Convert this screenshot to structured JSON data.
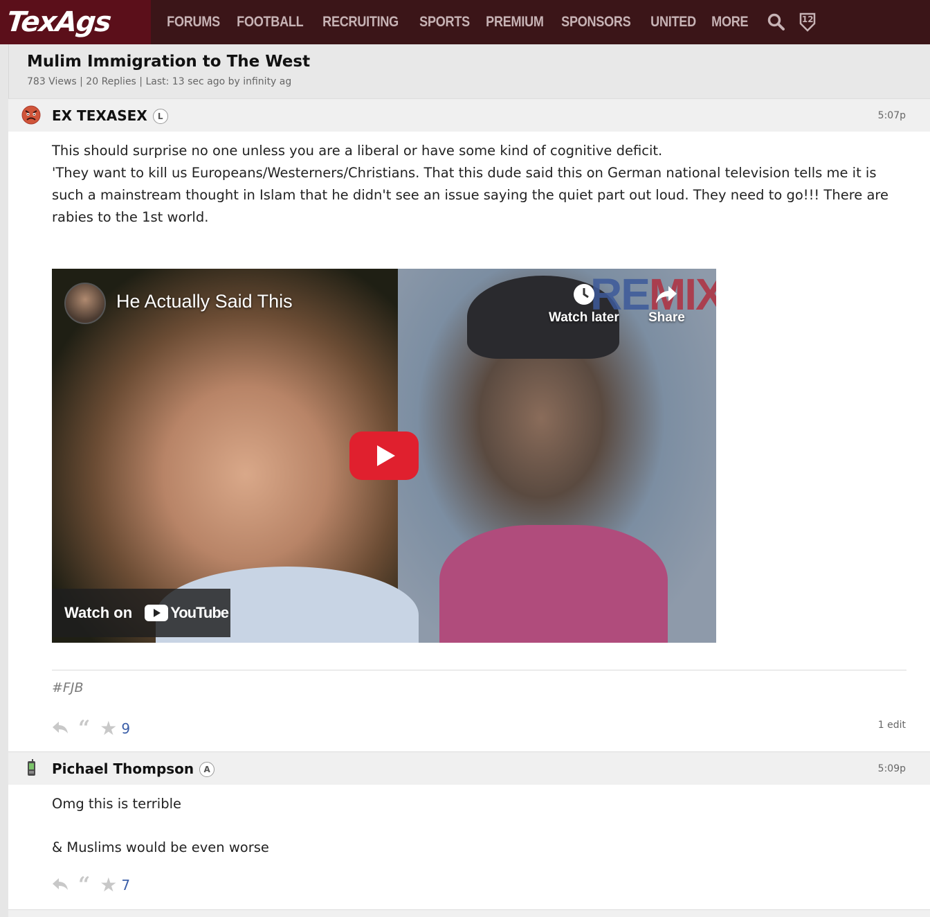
{
  "site": {
    "logo": "TexAgs",
    "nav": [
      "FORUMS",
      "FOOTBALL",
      "RECRUITING",
      "SPORTS",
      "PREMIUM",
      "SPONSORS",
      "UNITED",
      "MORE"
    ],
    "badge_number": "12",
    "primary_color": "#3b1518",
    "logo_bg": "#5b0f1a"
  },
  "thread": {
    "title": "Mulim Immigration to The West",
    "meta": "783 Views | 20 Replies | Last: 13 sec ago by infinity ag"
  },
  "posts": [
    {
      "author": "EX TEXASEX",
      "badge": "L",
      "time": "5:07p",
      "avatar_icon": "angry-face-icon",
      "body": [
        "This should surprise no one unless you are a liberal or have some kind of cognitive deficit.",
        "'They want to kill us Europeans/Westerners/Christians. That this dude said this on German national television tells me it is such a mainstream thought in Islam that he didn't see an issue saying the quiet part out loud. They need to go!!! There are rabies to the 1st world."
      ],
      "video": {
        "title": "He Actually Said This",
        "watch_later": "Watch later",
        "share": "Share",
        "watch_on": "Watch on",
        "youtube": "YouTube",
        "overlay_re": "RE",
        "overlay_mix": "MIX"
      },
      "signature": "#FJB",
      "stars": "9",
      "edit_note": "1 edit"
    },
    {
      "author": "Pichael Thompson",
      "badge": "A",
      "time": "5:09p",
      "avatar_icon": "mobile-phone-icon",
      "body": [
        "Omg this is terrible",
        "& Muslims would be even worse"
      ],
      "stars": "7"
    }
  ]
}
